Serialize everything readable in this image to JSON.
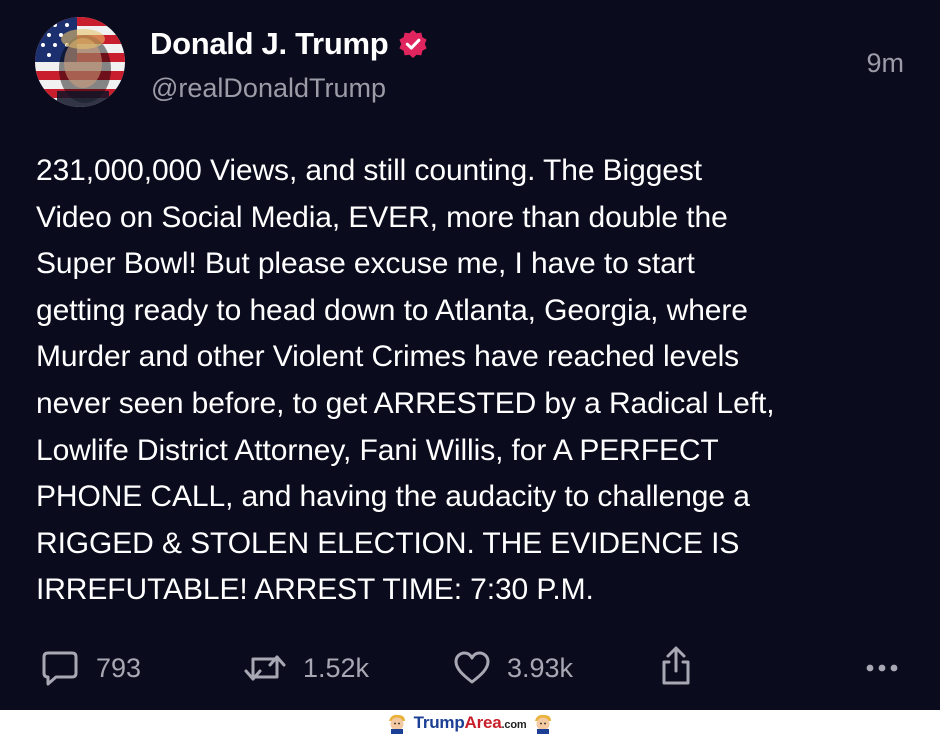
{
  "author": {
    "display_name": "Donald J. Trump",
    "handle": "@realDonaldTrump",
    "verified": true
  },
  "post": {
    "time_ago": "9m",
    "text": "231,000,000 Views, and still counting. The Biggest\nVideo on Social Media, EVER, more than double the\nSuper Bowl! But please excuse me, I have to start\ngetting ready to head down to Atlanta, Georgia, where\nMurder and other Violent Crimes have reached levels\nnever seen before, to get ARRESTED by a Radical Left,\nLowlife District Attorney, Fani Willis, for A PERFECT\nPHONE CALL, and having the audacity to challenge a\nRIGGED & STOLEN ELECTION. THE EVIDENCE IS\nIRREFUTABLE! ARREST TIME: 7:30 P.M."
  },
  "actions": {
    "replies": {
      "icon": "speech-bubble-icon",
      "count": "793"
    },
    "reposts": {
      "icon": "repost-arrows-icon",
      "count": "1.52k"
    },
    "likes": {
      "icon": "heart-icon",
      "count": "3.93k"
    },
    "share": {
      "icon": "share-icon"
    },
    "more": {
      "icon": "more-dots-icon"
    }
  },
  "watermark": {
    "brand_main": "Trump",
    "brand_accent": "Area",
    "brand_tld": ".com"
  },
  "colors": {
    "background": "#0a0b1c",
    "text": "#ffffff",
    "muted": "#9c9ca8",
    "verified_badge": "#e0245e"
  }
}
